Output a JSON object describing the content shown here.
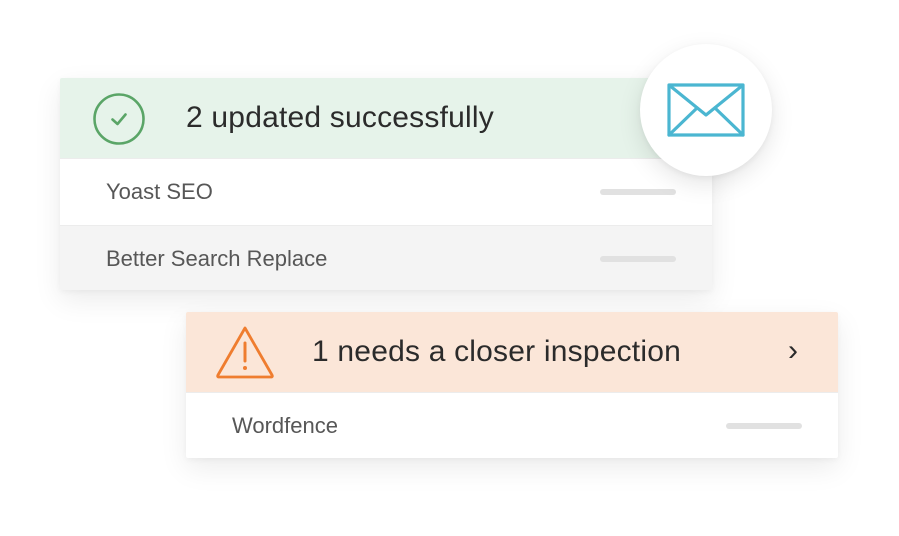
{
  "success_panel": {
    "title": "2 updated successfully",
    "icon": "check-circle-icon",
    "accent_color": "#5aa567",
    "header_bg": "#e6f3ea",
    "items": [
      {
        "label": "Yoast SEO"
      },
      {
        "label": "Better Search Replace"
      }
    ]
  },
  "mail_badge": {
    "icon": "envelope-icon",
    "color": "#4bb6d1"
  },
  "warning_panel": {
    "title": "1 needs a closer inspection",
    "icon": "warning-triangle-icon",
    "accent_color": "#ef7d2f",
    "header_bg": "#fbe6d8",
    "chevron": "›",
    "items": [
      {
        "label": "Wordfence"
      }
    ]
  }
}
